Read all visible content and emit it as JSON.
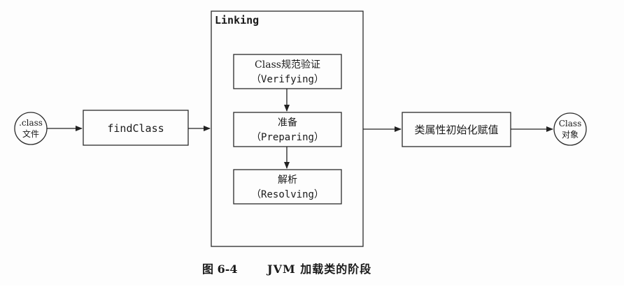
{
  "diagram": {
    "source": {
      "line1": ".class",
      "line2": "文件"
    },
    "find_class": {
      "label": "findClass"
    },
    "linking": {
      "title": "Linking",
      "verifying": {
        "line1": "Class规范验证",
        "line2": "（Verifying）"
      },
      "preparing": {
        "line1": "准备",
        "line2": "（Preparing）"
      },
      "resolving": {
        "line1": "解析",
        "line2": "（Resolving）"
      }
    },
    "init": {
      "label": "类属性初始化赋值"
    },
    "target": {
      "line1": "Class",
      "line2": "对象"
    }
  },
  "caption": {
    "number": "图 6-4",
    "text": "JVM 加载类的阶段"
  },
  "colors": {
    "stroke": "#2a2a2a",
    "text": "#1a1a1a",
    "background": "#fdfdfd"
  }
}
